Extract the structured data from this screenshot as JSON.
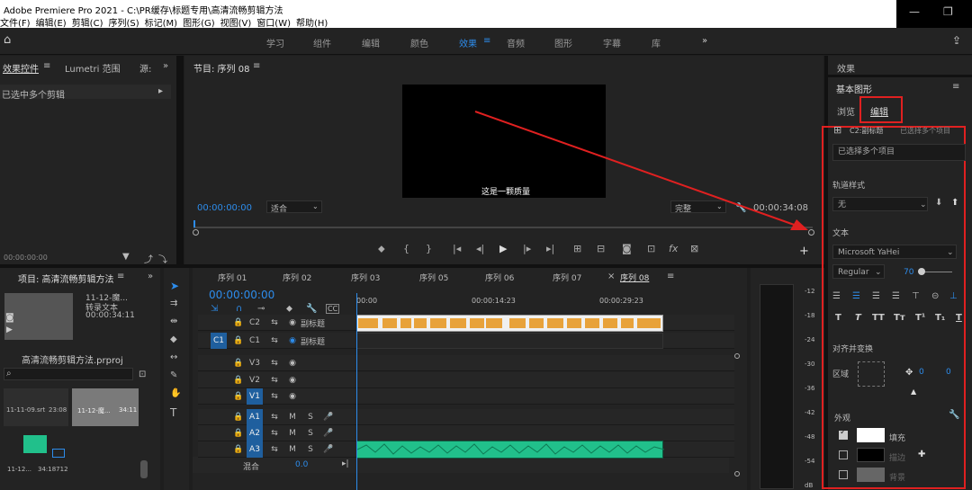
{
  "titlebar": {
    "title": "Adobe Premiere Pro 2021 - C:\\PR缓存\\标题专用\\高清流畅剪辑方法",
    "menus": [
      "文件(F)",
      "编辑(E)",
      "剪辑(C)",
      "序列(S)",
      "标记(M)",
      "图形(G)",
      "视图(V)",
      "窗口(W)",
      "帮助(H)"
    ]
  },
  "workspaces": [
    "学习",
    "组件",
    "编辑",
    "颜色",
    "效果",
    "音频",
    "图形",
    "字幕",
    "库"
  ],
  "effect_controls": {
    "tab1": "效果控件",
    "tab2": "Lumetri 范围",
    "tab3": "源:",
    "message": "已选中多个剪辑",
    "timecode": "00:00:00:00"
  },
  "program": {
    "title": "节目: 序列 08",
    "caption": "这是一颗质量",
    "timecode": "00:00:00:00",
    "fit": "适合",
    "quality": "完整",
    "duration": "00:00:34:08"
  },
  "project": {
    "title": "项目: 高清流畅剪辑方法",
    "clip_name": "11-12-魔...",
    "clip_desc": "转录文本",
    "clip_dur": "00:00:34:11",
    "file": "高清流畅剪辑方法.prproj",
    "bin": [
      {
        "name": "11-11-09.srt",
        "dur": "23:08"
      },
      {
        "name": "11-12-魔...",
        "dur": "34:11"
      },
      {
        "name": "11-12...",
        "dur": "34:18712"
      }
    ]
  },
  "timeline": {
    "tabs": [
      "序列 01",
      "序列 02",
      "序列 03",
      "序列 05",
      "序列 06",
      "序列 07",
      "序列 08"
    ],
    "timecode": "00:00:00:00",
    "ruler": [
      "00:00",
      "00:00:14:23",
      "00:00:29:23"
    ],
    "tracks": [
      {
        "id": "C2",
        "name": "副标题"
      },
      {
        "id": "C1",
        "name": "副标题"
      },
      {
        "id": "V3",
        "name": ""
      },
      {
        "id": "V2",
        "name": ""
      },
      {
        "id": "V1",
        "name": ""
      },
      {
        "id": "A1",
        "name": ""
      },
      {
        "id": "A2",
        "name": ""
      },
      {
        "id": "A3",
        "name": ""
      }
    ],
    "mix": "混合",
    "mix_val": "0.0"
  },
  "meter": {
    "labels": [
      "-12",
      "-18",
      "-24",
      "-30",
      "-36",
      "-42",
      "-48",
      "-54",
      "dB"
    ]
  },
  "egp": {
    "panel": "效果",
    "title": "基本图形",
    "tab_browse": "浏览",
    "tab_edit": "编辑",
    "layer": "C2:副标题",
    "multi": "已选择多个项目",
    "multi_box": "已选择多个项目",
    "track_style_label": "轨道样式",
    "track_style": "无",
    "text_label": "文本",
    "font": "Microsoft YaHei",
    "weight": "Regular",
    "size": "70",
    "align_label": "对齐并变换",
    "area_label": "区域",
    "pos_x": "0",
    "pos_y": "0",
    "appearance_label": "外观",
    "fill": "填充",
    "stroke": "描边",
    "shadow": "背景"
  },
  "colors": {
    "accent": "#2d8ceb",
    "highlight": "#e02020",
    "clip_orange": "#e8a23a",
    "audio_green": "#21c08b"
  }
}
